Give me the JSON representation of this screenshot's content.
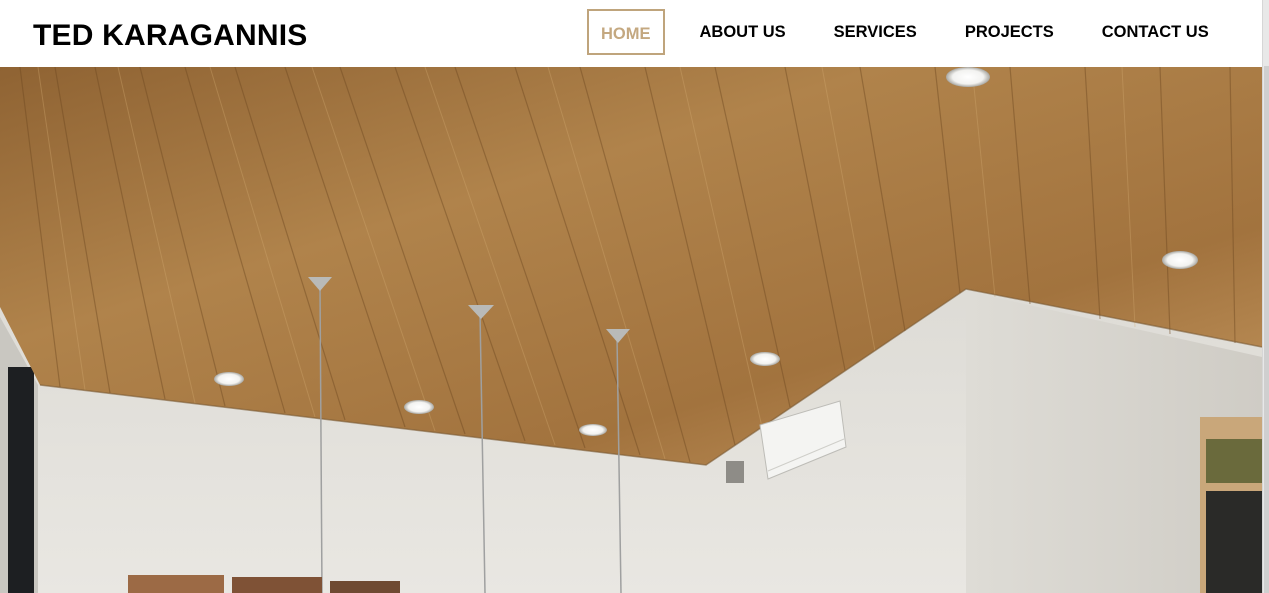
{
  "site": {
    "brand": "TED KARAGANNIS"
  },
  "nav": {
    "items": [
      {
        "label": "HOME",
        "active": true
      },
      {
        "label": "ABOUT US",
        "active": false
      },
      {
        "label": "SERVICES",
        "active": false
      },
      {
        "label": "PROJECTS",
        "active": false
      },
      {
        "label": "CONTACT US",
        "active": false
      }
    ]
  },
  "hero": {
    "image": "interior-wood-ceiling-photo"
  },
  "colors": {
    "accent": "#bfa47c",
    "text": "#000000",
    "background": "#ffffff",
    "wood": "#a9773f",
    "wall": "#e4e2dc"
  }
}
